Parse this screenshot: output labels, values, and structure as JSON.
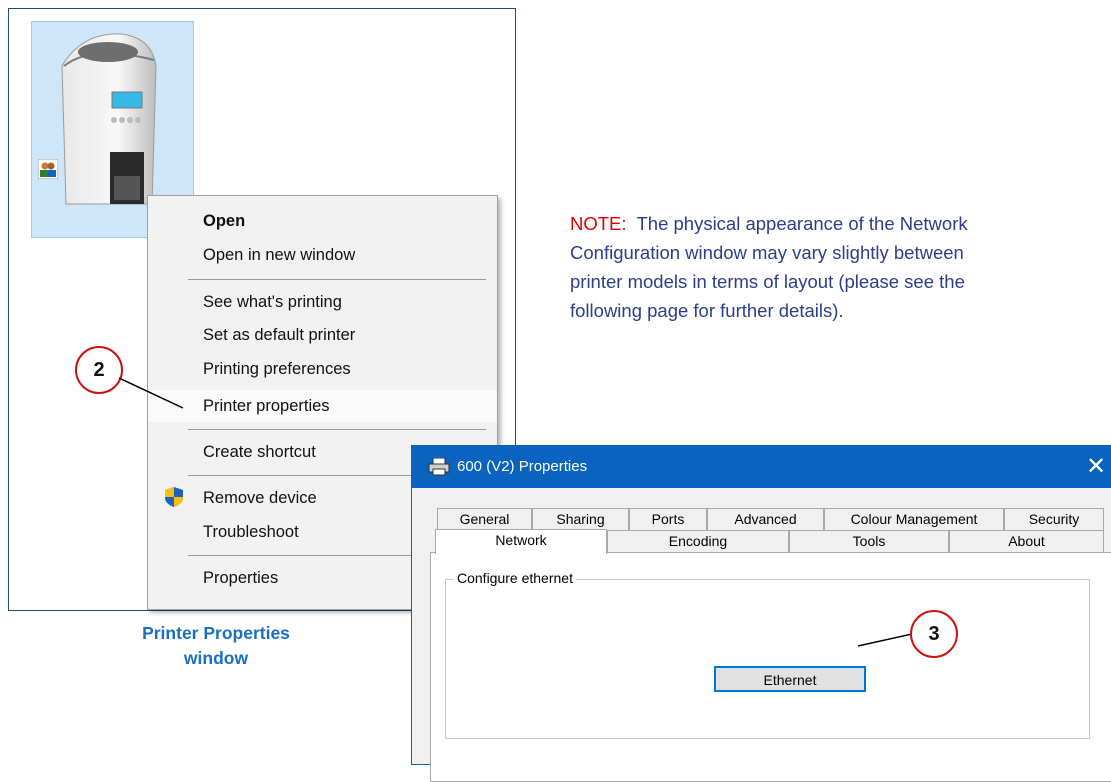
{
  "explorer": {
    "caption_line1": "Printer Properties",
    "caption_line2": "window"
  },
  "context_menu": {
    "items": [
      {
        "label": "Open",
        "bold": true
      },
      {
        "label": "Open in new window"
      },
      {
        "label": "See what's printing"
      },
      {
        "label": "Set as default printer"
      },
      {
        "label": "Printing preferences"
      },
      {
        "label": "Printer properties",
        "highlighted": true
      },
      {
        "label": "Create shortcut"
      },
      {
        "label": "Remove device",
        "icon": "uac-shield-icon"
      },
      {
        "label": "Troubleshoot"
      },
      {
        "label": "Properties"
      }
    ]
  },
  "note": {
    "label": "NOTE:",
    "line1": "  The physical appearance of the Network",
    "line2": "Configuration window may vary slightly between",
    "line3": "printer models in terms of layout (please see the",
    "line4": "following page for further details)."
  },
  "callouts": {
    "step2": "2",
    "step3": "3"
  },
  "dialog": {
    "title": "600 (V2) Properties",
    "close_symbol": "✕",
    "tabs_row1": [
      "General",
      "Sharing",
      "Ports",
      "Advanced",
      "Colour Management",
      "Security"
    ],
    "tabs_row2": [
      "Network",
      "Encoding",
      "Tools",
      "About"
    ],
    "active_tab": "Network",
    "group_label": "Configure ethernet",
    "button_label": "Ethernet"
  },
  "colors": {
    "accent_blue": "#0a63bf",
    "callout_red": "#d01010",
    "note_red": "#e00000",
    "note_text": "#2c3e8a",
    "caption_blue": "#1a6fc0"
  }
}
